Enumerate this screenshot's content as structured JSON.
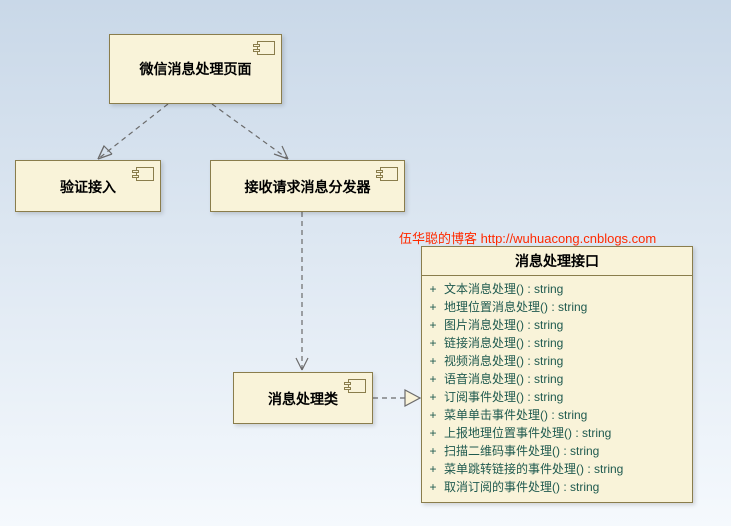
{
  "watermark": "伍华聪的博客 http://wuhuacong.cnblogs.com",
  "boxes": {
    "page": {
      "title": "微信消息处理页面"
    },
    "verify": {
      "title": "验证接入"
    },
    "dispatcher": {
      "title": "接收请求消息分发器"
    },
    "handler": {
      "title": "消息处理类"
    },
    "interface": {
      "title": "消息处理接口",
      "ops": [
        "文本消息处理() : string",
        "地理位置消息处理() : string",
        "图片消息处理() : string",
        "链接消息处理() : string",
        "视频消息处理() : string",
        "语音消息处理() : string",
        "订阅事件处理() : string",
        "菜单单击事件处理() : string",
        "上报地理位置事件处理() : string",
        "扫描二维码事件处理() : string",
        "菜单跳转链接的事件处理() : string",
        "取消订阅的事件处理() : string"
      ]
    }
  },
  "chart_data": {
    "type": "table",
    "title": "UML component / interface diagram",
    "nodes": [
      {
        "id": "page",
        "label": "微信消息处理页面",
        "kind": "component"
      },
      {
        "id": "verify",
        "label": "验证接入",
        "kind": "component"
      },
      {
        "id": "dispatcher",
        "label": "接收请求消息分发器",
        "kind": "component"
      },
      {
        "id": "handler",
        "label": "消息处理类",
        "kind": "component"
      },
      {
        "id": "interface",
        "label": "消息处理接口",
        "kind": "interface",
        "operations": [
          "文本消息处理() : string",
          "地理位置消息处理() : string",
          "图片消息处理() : string",
          "链接消息处理() : string",
          "视频消息处理() : string",
          "语音消息处理() : string",
          "订阅事件处理() : string",
          "菜单单击事件处理() : string",
          "上报地理位置事件处理() : string",
          "扫描二维码事件处理() : string",
          "菜单跳转链接的事件处理() : string",
          "取消订阅的事件处理() : string"
        ]
      }
    ],
    "edges": [
      {
        "from": "page",
        "to": "verify",
        "type": "dependency"
      },
      {
        "from": "page",
        "to": "dispatcher",
        "type": "dependency"
      },
      {
        "from": "dispatcher",
        "to": "handler",
        "type": "dependency"
      },
      {
        "from": "handler",
        "to": "interface",
        "type": "realization"
      }
    ]
  }
}
